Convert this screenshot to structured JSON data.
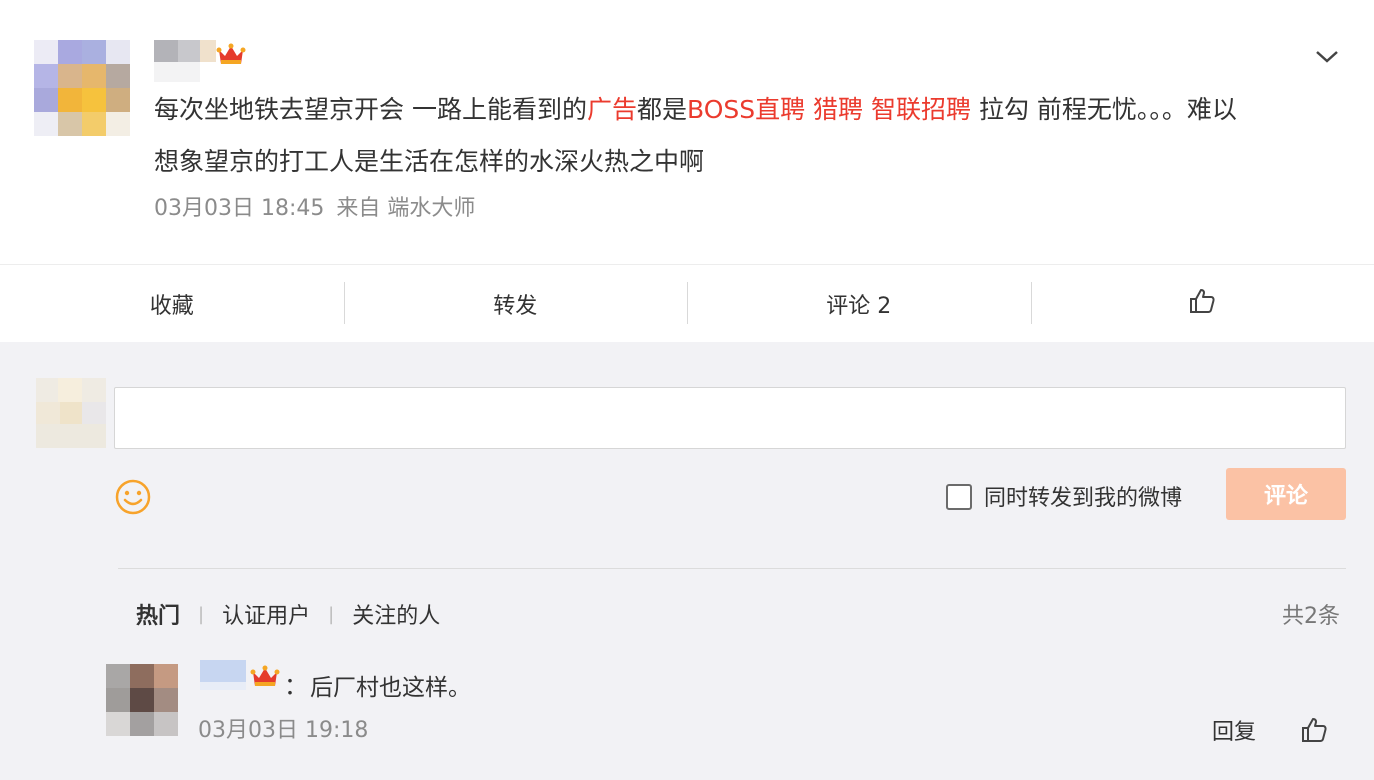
{
  "post": {
    "text_segments": [
      {
        "text": "每次坐地铁去望京开会 一路上能看到的",
        "highlight": false
      },
      {
        "text": "广告",
        "highlight": true
      },
      {
        "text": "都是",
        "highlight": false
      },
      {
        "text": "BOSS直聘 猎聘 智联招聘",
        "highlight": true
      },
      {
        "text": " 拉勾 前程无忧。。。难以想象望京的打工人是生活在怎样的水深火热之中啊",
        "highlight": false
      }
    ],
    "date": "03月03日 18:45",
    "source": "来自 端水大师"
  },
  "actions": {
    "favorite": "收藏",
    "repost": "转发",
    "comment": "评论 2"
  },
  "composer": {
    "input_value": "",
    "repost_label": "同时转发到我的微博",
    "submit_label": "评论"
  },
  "comments_header": {
    "tabs": [
      "热门",
      "认证用户",
      "关注的人"
    ],
    "total": "共2条"
  },
  "comments": [
    {
      "colon": "：",
      "text": "后厂村也这样。",
      "time": "03月03日 19:18",
      "reply_label": "回复"
    }
  ],
  "colors": {
    "highlight": "#eb3b2e",
    "submit_bg": "#fbc2a5",
    "emoji": "#f7a32b",
    "crown": "#f5a623"
  },
  "icons": {
    "collapse": "chevron-down-icon",
    "like": "thumbs-up-icon",
    "emoji": "smiley-face-icon",
    "vip": "crown-icon"
  }
}
